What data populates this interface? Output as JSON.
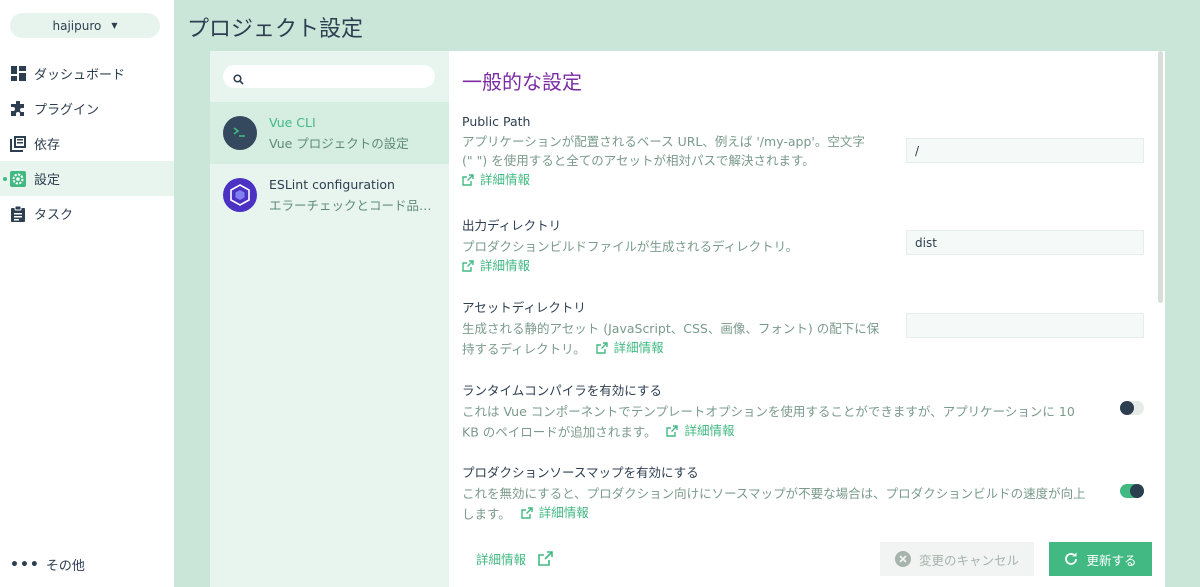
{
  "nav": {
    "project": "hajipuro",
    "items": [
      {
        "label": "ダッシュボード",
        "icon": "dashboard-icon"
      },
      {
        "label": "プラグイン",
        "icon": "puzzle-icon"
      },
      {
        "label": "依存",
        "icon": "library-icon"
      },
      {
        "label": "設定",
        "icon": "settings-icon",
        "active": true
      },
      {
        "label": "タスク",
        "icon": "clipboard-icon"
      }
    ],
    "more": "その他"
  },
  "page_title": "プロジェクト設定",
  "search": {
    "placeholder": ""
  },
  "plugins": [
    {
      "name": "Vue CLI",
      "desc": "Vue プロジェクトの設定",
      "active": true
    },
    {
      "name": "ESLint configuration",
      "desc": "エラーチェックとコード品質の設定"
    }
  ],
  "content": {
    "title": "一般的な設定",
    "more_label": "詳細情報",
    "settings": [
      {
        "title": "Public Path",
        "desc": "アプリケーションが配置されるベース URL、例えば '/my-app'。空文字 (\" \") を使用すると全てのアセットが相対パスで解決されます。",
        "value": "/"
      },
      {
        "title": "出力ディレクトリ",
        "desc": "プロダクションビルドファイルが生成されるディレクトリ。",
        "value": "dist"
      },
      {
        "title": "アセットディレクトリ",
        "desc": "生成される静的アセット (JavaScript、CSS、画像、フォント) の配下に保持するディレクトリ。",
        "value": ""
      },
      {
        "title": "ランタイムコンパイラを有効にする",
        "desc": "これは Vue コンポーネントでテンプレートオプションを使用することができますが、アプリケーションに 10 KB のペイロードが追加されます。",
        "enabled": false
      },
      {
        "title": "プロダクションソースマップを有効にする",
        "desc": "これを無効にすると、プロダクション向けにソースマップが不要な場合は、プロダクションビルドの速度が向上します。",
        "enabled": true
      }
    ]
  },
  "footer": {
    "more": "詳細情報",
    "cancel": "変更のキャンセル",
    "update": "更新する"
  },
  "colors": {
    "accent": "#42b983",
    "title_purple": "#7b2ca5",
    "dark": "#2c3e50"
  }
}
